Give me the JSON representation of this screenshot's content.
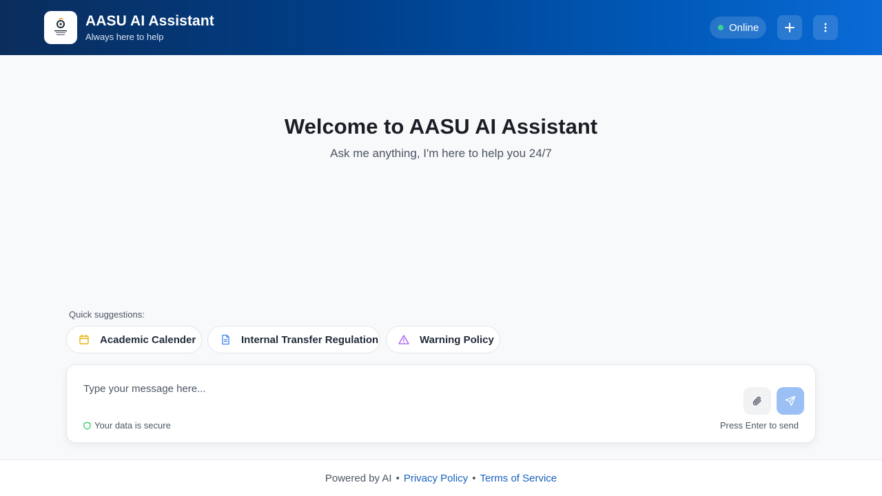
{
  "header": {
    "title": "AASU AI Assistant",
    "subtitle": "Always here to help",
    "status": "Online",
    "logo_icon": "university-logo-icon",
    "new_chat_icon": "plus-icon",
    "menu_icon": "more-vertical-icon"
  },
  "welcome": {
    "title": "Welcome to AASU AI Assistant",
    "subtitle": "Ask me anything, I'm here to help you 24/7"
  },
  "suggestions": {
    "label": "Quick suggestions:",
    "items": [
      {
        "label": "Academic Calender",
        "icon": "calendar-icon",
        "color": "#eab308"
      },
      {
        "label": "Internal Transfer Regulation",
        "icon": "document-icon",
        "color": "#3b82f6"
      },
      {
        "label": "Warning Policy",
        "icon": "warning-icon",
        "color": "#a855f7"
      }
    ]
  },
  "composer": {
    "placeholder": "Type your message here...",
    "secure_text": "Your data is secure",
    "enter_hint": "Press Enter to send",
    "attach_icon": "paperclip-icon",
    "send_icon": "send-icon"
  },
  "footer": {
    "powered": "Powered by AI",
    "separator": "•",
    "privacy": "Privacy Policy",
    "terms": "Terms of Service"
  },
  "colors": {
    "accent": "#0059b8",
    "status_dot": "#34d399",
    "send_button": "#9cc0f5",
    "link": "#1560bd"
  }
}
